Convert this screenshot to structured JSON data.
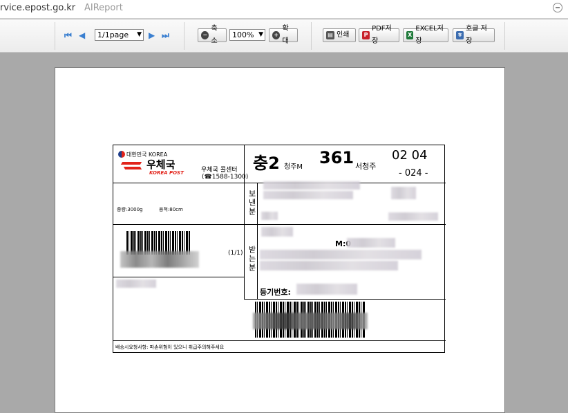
{
  "browser": {
    "url": "rvice.epost.go.kr",
    "app_name": "AIReport"
  },
  "toolbar": {
    "first_page": "⏮",
    "prev_page": "◀",
    "page_select": "1/1page",
    "next_page": "▶",
    "last_page": "⏭",
    "zoom_out_label": "축소",
    "zoom_select": "100%",
    "zoom_in_label": "확대",
    "print_label": "인쇄",
    "pdf_label": "PDF저장",
    "excel_label": "EXCEL저장",
    "hangul_label": "호글 저장"
  },
  "label": {
    "country": "대한민국 KOREA",
    "brand_kr": "우체국",
    "brand_en": "KOREA POST",
    "call_center": "우체국 콜센터",
    "phone": "(☎1588-1300)",
    "sort_code_1": "충2",
    "sort_sub_1": "청주M",
    "sort_code_2": "361",
    "sort_sub_2": "서청주",
    "sort_code_3": "02 04",
    "sort_code_4": "- 024 -",
    "weight": "중량:3000g",
    "volume": "용적:80cm",
    "sender_label": "보낸분",
    "receiver_label": "받는분",
    "count": "(1/1)",
    "mobile_prefix": "M:0",
    "registration_label": "등기번호:",
    "footer_note": "배송시요청사항: 파손위험이 있으니 취급주의해주세요"
  },
  "colors": {
    "brand_red": "#e2231a",
    "toolbar_blue": "#3a7fd0",
    "pdf_red": "#c8202a",
    "excel_green": "#1f7a3a",
    "hangul_blue": "#3c6db0"
  }
}
